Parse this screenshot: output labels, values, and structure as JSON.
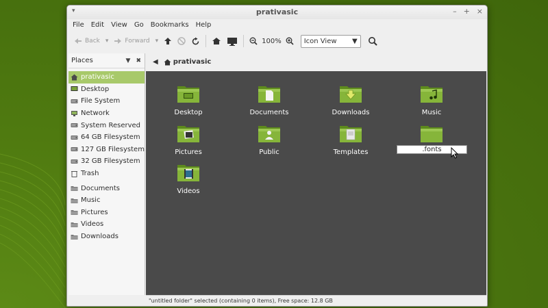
{
  "window": {
    "title": "prativasic"
  },
  "menu": [
    "File",
    "Edit",
    "View",
    "Go",
    "Bookmarks",
    "Help"
  ],
  "toolbar": {
    "back_label": "Back",
    "forward_label": "Forward",
    "zoom_level": "100%",
    "view_mode": "Icon View"
  },
  "sidebar": {
    "header": "Places",
    "items": [
      {
        "label": "prativasic",
        "icon": "home-icon",
        "selected": true
      },
      {
        "label": "Desktop",
        "icon": "desktop-icon"
      },
      {
        "label": "File System",
        "icon": "drive-icon"
      },
      {
        "label": "Network",
        "icon": "network-icon"
      },
      {
        "label": "System Reserved",
        "icon": "drive-icon"
      },
      {
        "label": "64 GB Filesystem",
        "icon": "drive-icon"
      },
      {
        "label": "127 GB Filesystem",
        "icon": "drive-icon"
      },
      {
        "label": "32 GB Filesystem",
        "icon": "drive-icon"
      },
      {
        "label": "Trash",
        "icon": "trash-icon"
      },
      {
        "label": "Documents",
        "icon": "folder-icon"
      },
      {
        "label": "Music",
        "icon": "folder-icon"
      },
      {
        "label": "Pictures",
        "icon": "folder-icon"
      },
      {
        "label": "Videos",
        "icon": "folder-icon"
      },
      {
        "label": "Downloads",
        "icon": "folder-icon"
      }
    ]
  },
  "pathbar": {
    "current": "prativasic"
  },
  "files": [
    {
      "name": "Desktop",
      "icon": "desktop-folder-icon"
    },
    {
      "name": "Documents",
      "icon": "documents-folder-icon"
    },
    {
      "name": "Downloads",
      "icon": "downloads-folder-icon"
    },
    {
      "name": "Music",
      "icon": "music-folder-icon"
    },
    {
      "name": "Pictures",
      "icon": "pictures-folder-icon"
    },
    {
      "name": "Public",
      "icon": "public-folder-icon"
    },
    {
      "name": "Templates",
      "icon": "templates-folder-icon"
    },
    {
      "name": ".fonts",
      "icon": "folder-icon",
      "renaming": true
    },
    {
      "name": "Videos",
      "icon": "videos-folder-icon"
    }
  ],
  "status": "\"untitled folder\" selected (containing 0 items), Free space: 12.8 GB",
  "colors": {
    "accent": "#a8c96a",
    "desktop": "#4f7a10",
    "content_bg": "#4a4a4a"
  }
}
